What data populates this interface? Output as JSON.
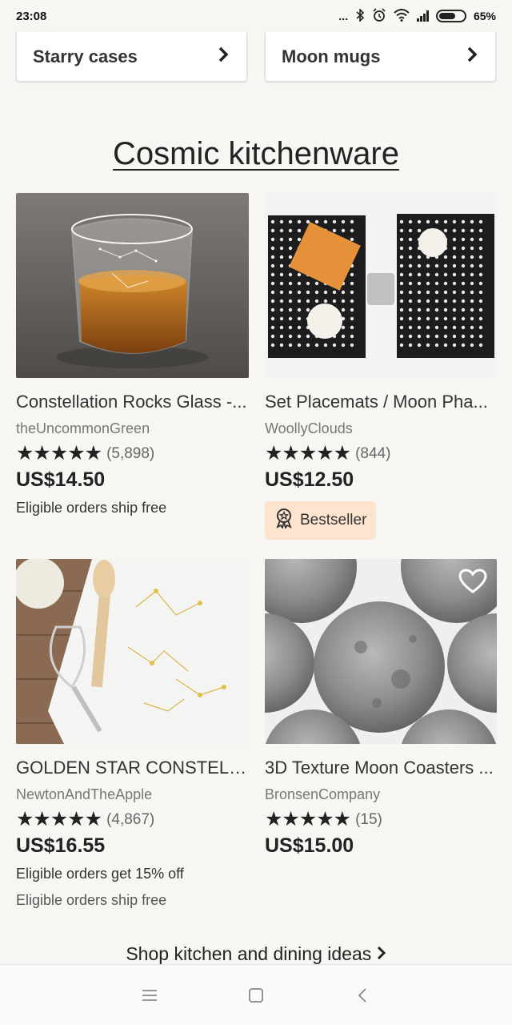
{
  "status": {
    "time": "23:08",
    "battery": "65%",
    "dots": "..."
  },
  "categories": [
    {
      "label": "Starry cases"
    },
    {
      "label": "Moon mugs"
    }
  ],
  "section_title": "Cosmic kitchenware",
  "products": [
    {
      "title": "Constellation Rocks Glass -...",
      "shop": "theUncommonGreen",
      "stars": "★★★★★",
      "reviews": "(5,898)",
      "price": "US$14.50",
      "notes": [
        "Eligible orders ship free"
      ]
    },
    {
      "title": "Set Placemats / Moon Pha...",
      "shop": "WoollyClouds",
      "stars": "★★★★★",
      "reviews": "(844)",
      "price": "US$12.50",
      "badge": "Bestseller"
    },
    {
      "title": "GOLDEN STAR CONSTELL...",
      "shop": "NewtonAndTheApple",
      "stars": "★★★★★",
      "reviews": "(4,867)",
      "price": "US$16.55",
      "notes": [
        "Eligible orders get 15% off",
        "Eligible orders ship free"
      ]
    },
    {
      "title": "3D Texture Moon Coasters ...",
      "shop": "BronsenCompany",
      "stars": "★★★★★",
      "reviews": "(15)",
      "price": "US$15.00"
    }
  ],
  "shop_link": "Shop kitchen and dining ideas",
  "nav": {
    "menu_icon": "menu-icon",
    "home_icon": "home-icon",
    "back_icon": "back-icon"
  },
  "colors": {
    "background": "#f7f6f3",
    "badge_bg": "#fde4cf"
  }
}
